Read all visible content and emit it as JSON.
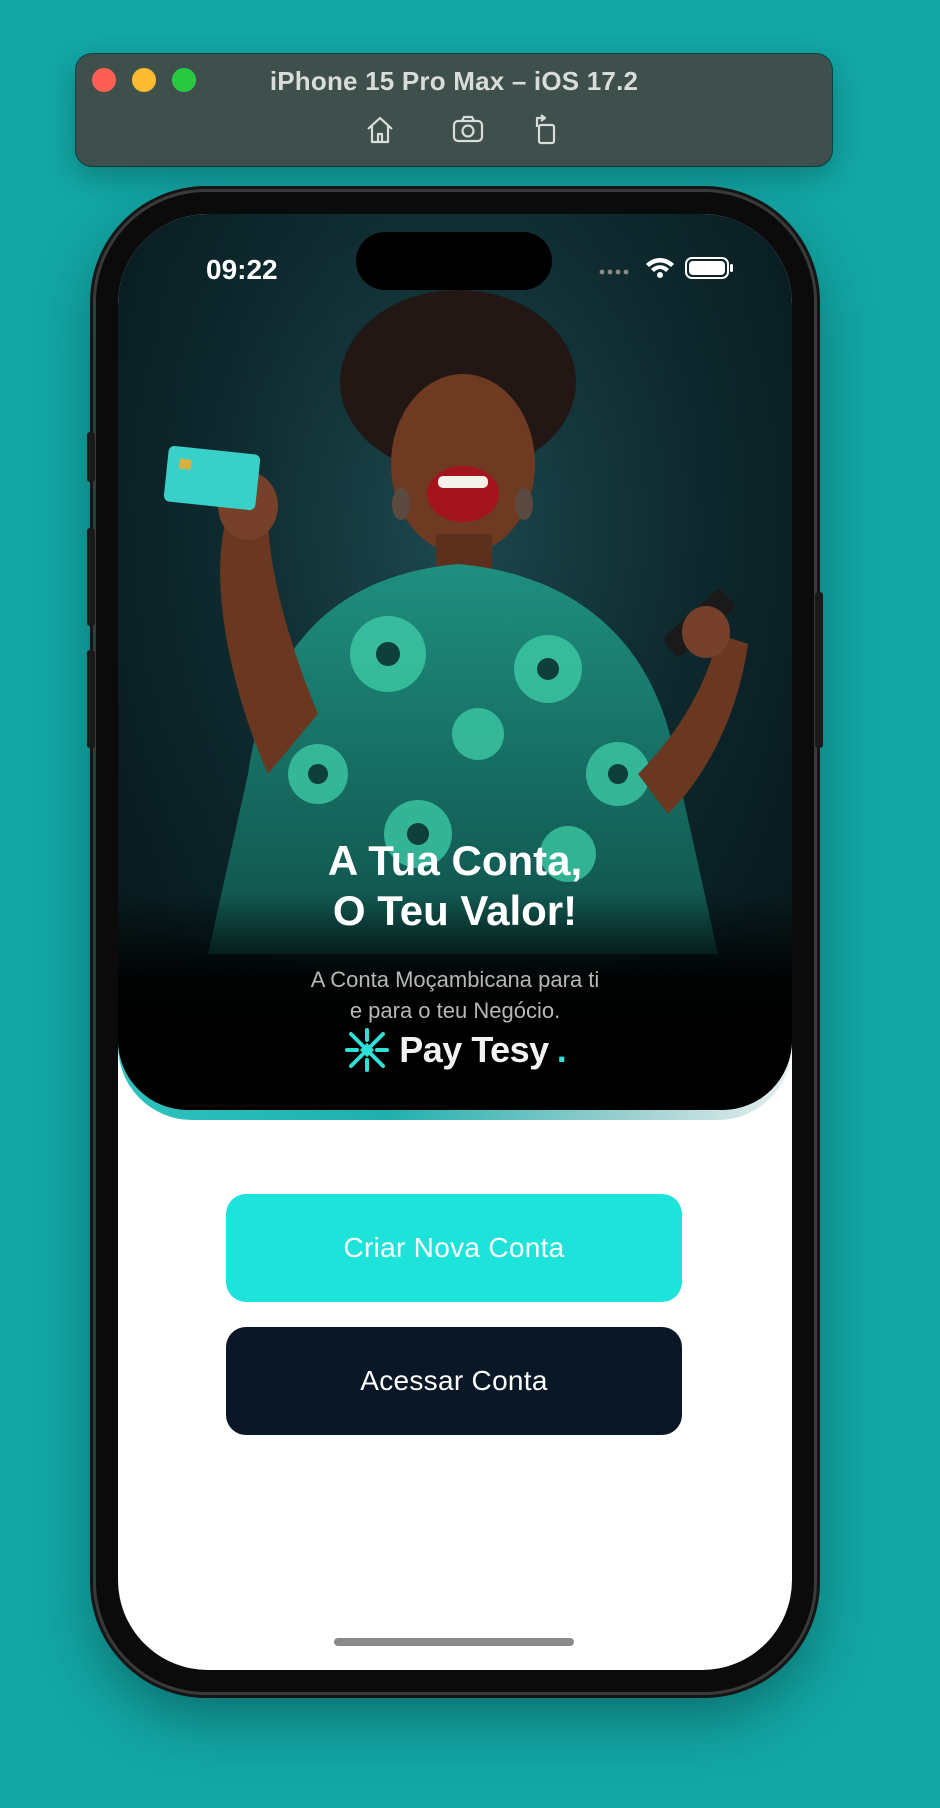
{
  "simulator": {
    "title": "iPhone 15 Pro Max – iOS 17.2",
    "tools": [
      "home-icon",
      "screenshot-icon",
      "rotate-icon"
    ]
  },
  "status_bar": {
    "time": "09:22"
  },
  "hero": {
    "title_line1": "A Tua Conta,",
    "title_line2": "O Teu Valor!",
    "subtitle_line1": "A Conta Moçambicana para ti",
    "subtitle_line2": "e para o teu Negócio.",
    "brand_name": "Pay Tesy",
    "brand_dot": "."
  },
  "actions": {
    "create_label": "Criar Nova Conta",
    "access_label": "Acessar Conta"
  },
  "colors": {
    "background": "#12a6a4",
    "accent": "#1ee3db",
    "dark_button": "#091726"
  }
}
